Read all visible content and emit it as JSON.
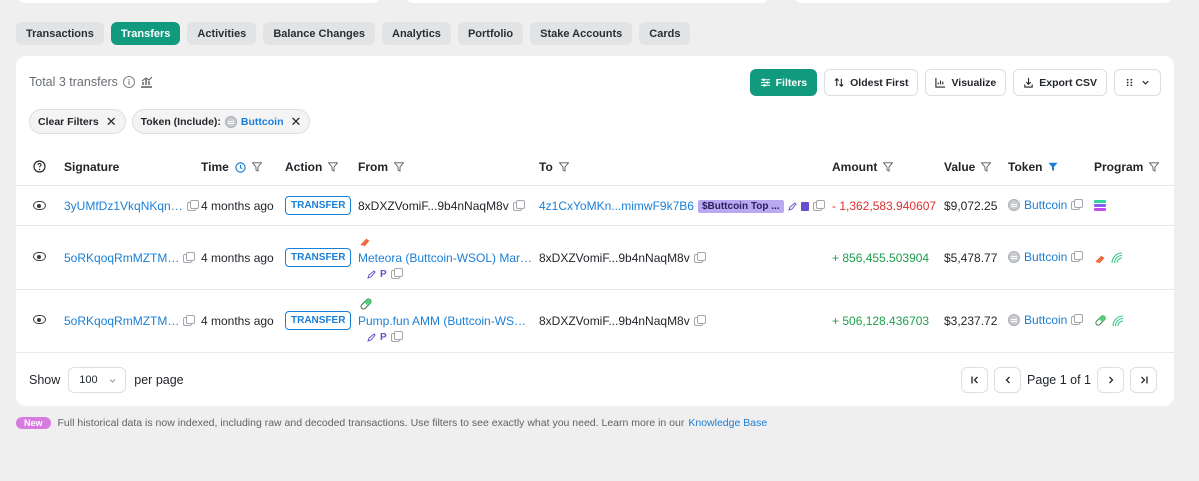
{
  "tabs": [
    "Transactions",
    "Transfers",
    "Activities",
    "Balance Changes",
    "Analytics",
    "Portfolio",
    "Stake Accounts",
    "Cards"
  ],
  "active_tab": "Transfers",
  "summary": {
    "total": "Total 3 transfers"
  },
  "toolbar": {
    "filters": "Filters",
    "sort": "Oldest First",
    "visualize": "Visualize",
    "export": "Export CSV"
  },
  "chips": {
    "clear": "Clear Filters",
    "token_label": "Token (Include):",
    "token_value": "Buttcoin"
  },
  "columns": {
    "signature": "Signature",
    "time": "Time",
    "action": "Action",
    "from": "From",
    "to": "To",
    "amount": "Amount",
    "value": "Value",
    "token": "Token",
    "program": "Program"
  },
  "rows": [
    {
      "signature": "3yUMfDz1VkqNKqn…",
      "time": "4 months ago",
      "action": "TRANSFER",
      "from": "8xDXZVomiF...9b4nNaqM8v",
      "to": "4z1CxYoMKn...mimwF9k7B6",
      "to_tag": "$Buttcoin Top ...",
      "amount": "- 1,362,583.940607",
      "value": "$9,072.25",
      "token": "Buttcoin"
    },
    {
      "signature": "5oRKqoqRmMZTM…",
      "time": "4 months ago",
      "action": "TRANSFER",
      "from": "Meteora (Buttcoin-WSOL) Mar…",
      "to": "8xDXZVomiF...9b4nNaqM8v",
      "amount": "+ 856,455.503904",
      "value": "$5,478.77",
      "token": "Buttcoin"
    },
    {
      "signature": "5oRKqoqRmMZTM…",
      "time": "4 months ago",
      "action": "TRANSFER",
      "from": "Pump.fun AMM (Buttcoin-WS…",
      "to": "8xDXZVomiF...9b4nNaqM8v",
      "amount": "+ 506,128.436703",
      "value": "$3,237.72",
      "token": "Buttcoin"
    }
  ],
  "footer": {
    "show": "Show",
    "per_page_value": "100",
    "per_page": "per page",
    "page": "Page 1 of 1"
  },
  "notice": {
    "badge": "New",
    "text": "Full historical data is now indexed, including raw and decoded transactions. Use filters to see exactly what you need. Learn more in our",
    "link": "Knowledge Base"
  },
  "colors": {
    "accent": "#129a7e",
    "link": "#1a7fd6",
    "negative": "#d9302f",
    "positive": "#1fa04c",
    "tag": "#b9a9f2",
    "new_badge": "#d77be0"
  },
  "icons": [
    "info-icon",
    "chart-icon",
    "filter-icon",
    "sort-icon",
    "visualize-icon",
    "export-icon",
    "columns-icon",
    "close-icon",
    "help-icon",
    "clock-icon",
    "funnel-icon",
    "eye-icon",
    "copy-icon",
    "coin-icon",
    "solana-icon",
    "meteora-icon",
    "pill-icon",
    "pencil-icon",
    "first-page-icon",
    "prev-icon",
    "next-icon",
    "last-page-icon"
  ]
}
